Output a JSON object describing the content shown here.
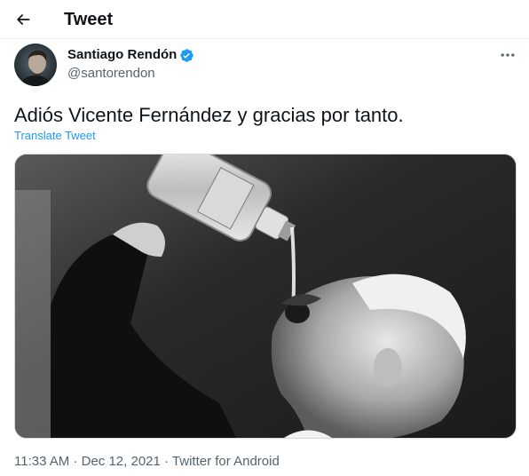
{
  "header": {
    "title": "Tweet",
    "back_icon": "arrow-left-icon"
  },
  "author": {
    "name": "Santiago Rendón",
    "handle": "@santorendon",
    "verified": true,
    "verified_color": "#1d9bf0",
    "more_icon": "more-horizontal-icon"
  },
  "tweet": {
    "text": "Adiós Vicente Fernández y gracias por tanto.",
    "translate_label": "Translate Tweet",
    "media_description_icon": "photo"
  },
  "meta": {
    "time": "11:33 AM",
    "sep1": " · ",
    "date": "Dec 12, 2021",
    "sep2": " · ",
    "source": "Twitter for Android"
  },
  "colors": {
    "accent": "#1d9bf0",
    "text_primary": "#0f1419",
    "text_secondary": "#536471",
    "border": "#eff3f4"
  }
}
